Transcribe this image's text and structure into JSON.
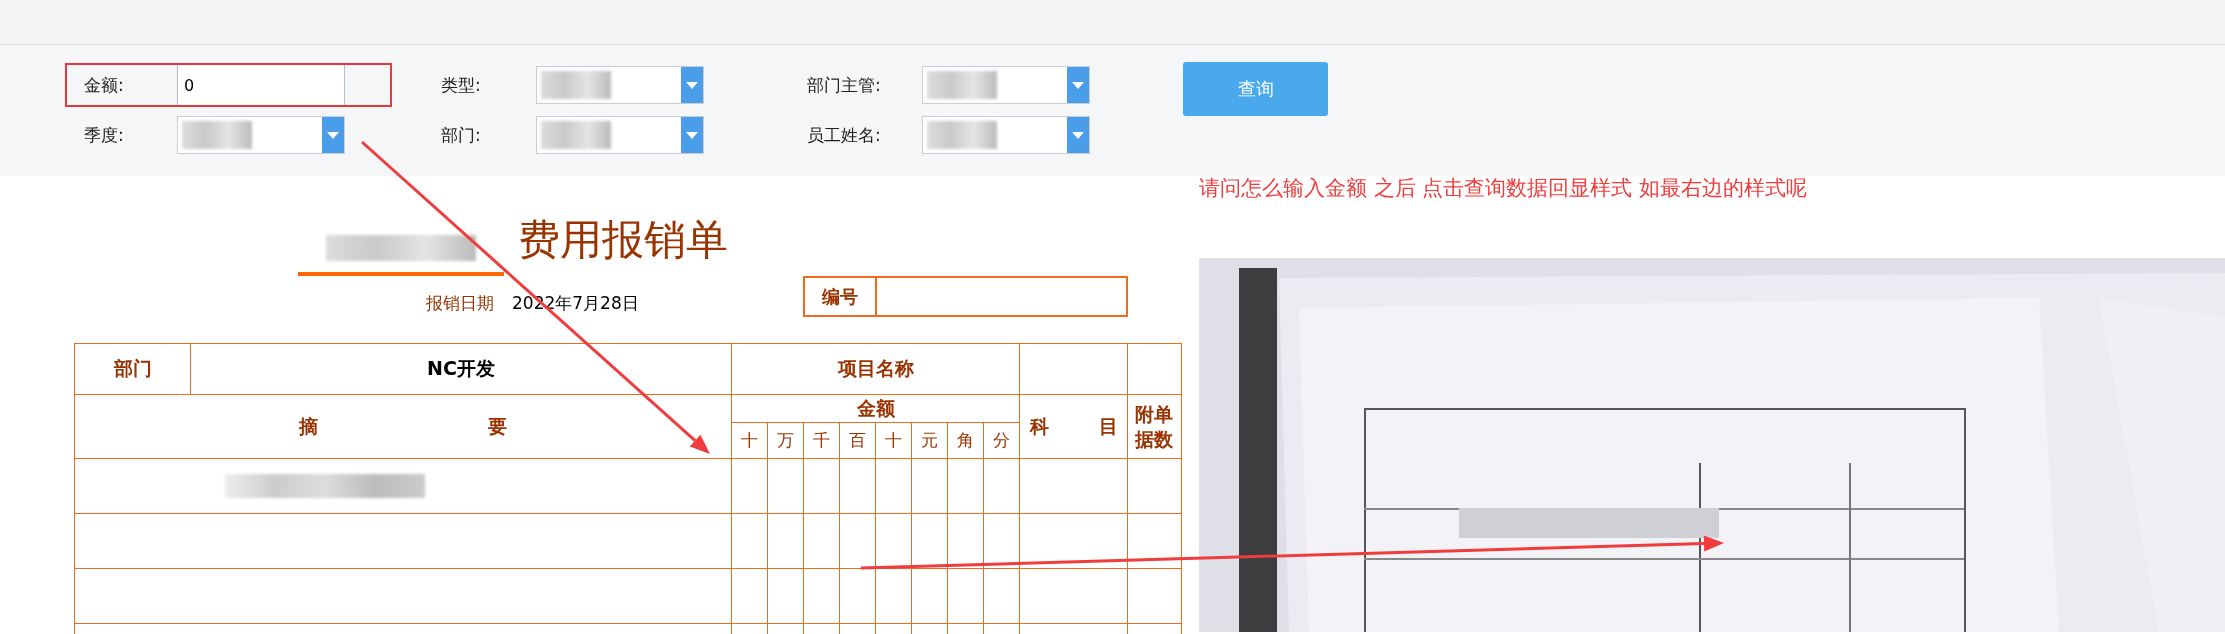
{
  "filters": [
    {
      "label": "金额:",
      "kind": "input",
      "value": "0",
      "highlighted": true
    },
    {
      "label": "类型:",
      "kind": "select",
      "highlighted": false
    },
    {
      "label": "部门主管:",
      "kind": "select",
      "highlighted": false
    },
    {
      "label": "季度:",
      "kind": "select",
      "highlighted": false
    },
    {
      "label": "部门:",
      "kind": "select",
      "highlighted": false
    },
    {
      "label": "员工姓名:",
      "kind": "select",
      "highlighted": false
    }
  ],
  "query_button": "查询",
  "annotation": "请问怎么输入金额 之后 点击查询数据回显样式 如最右边的样式呢",
  "form": {
    "title": "费用报销单",
    "date_label": "报销日期",
    "date": "2022年7月28日",
    "number_label": "编号",
    "table": {
      "dept_label": "部门",
      "dept_value": "NC开发",
      "project_label": "项目名称",
      "summary_label": [
        "摘",
        "要"
      ],
      "amount_label": "金额",
      "digits": [
        "十",
        "万",
        "千",
        "百",
        "十",
        "元",
        "角",
        "分"
      ],
      "subject_label": [
        "科",
        "目"
      ],
      "attachments_label": "附单据数"
    }
  }
}
